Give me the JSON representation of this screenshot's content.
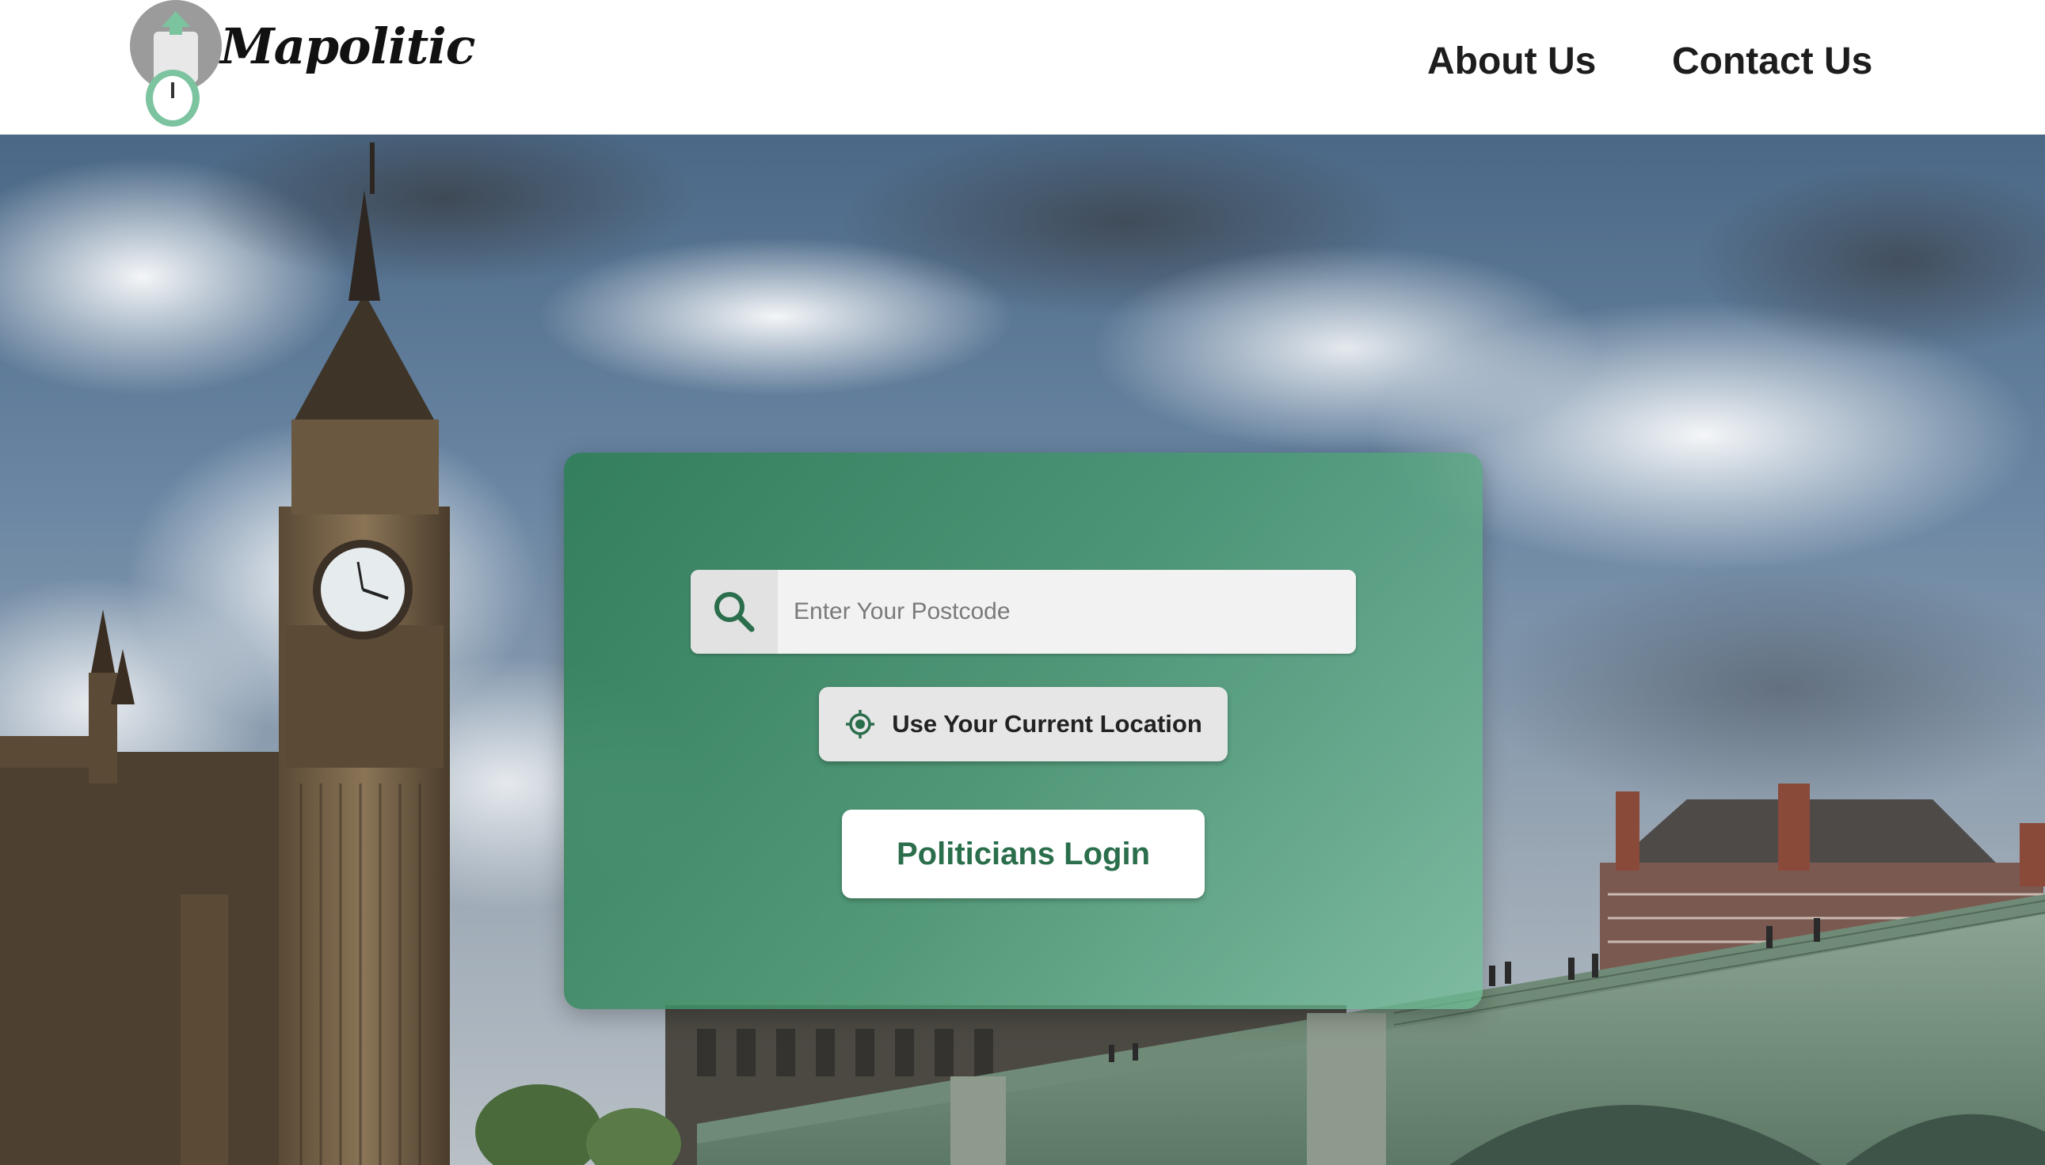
{
  "brand": {
    "name": "Mapolitic",
    "logo_icon": "ballot-box-mouse-logo"
  },
  "nav": {
    "about": "About Us",
    "contact": "Contact Us"
  },
  "hero": {
    "background": "london-big-ben-westminster-bridge-photo"
  },
  "search": {
    "icon": "search-icon",
    "placeholder": "Enter Your Postcode",
    "value": ""
  },
  "location_button": {
    "icon": "crosshair-location-icon",
    "label": "Use Your Current Location"
  },
  "login_button": {
    "label": "Politicians Login"
  },
  "colors": {
    "accent": "#2b6e4c",
    "card": "#3f8f66",
    "logo_green": "#7cc3a0"
  }
}
